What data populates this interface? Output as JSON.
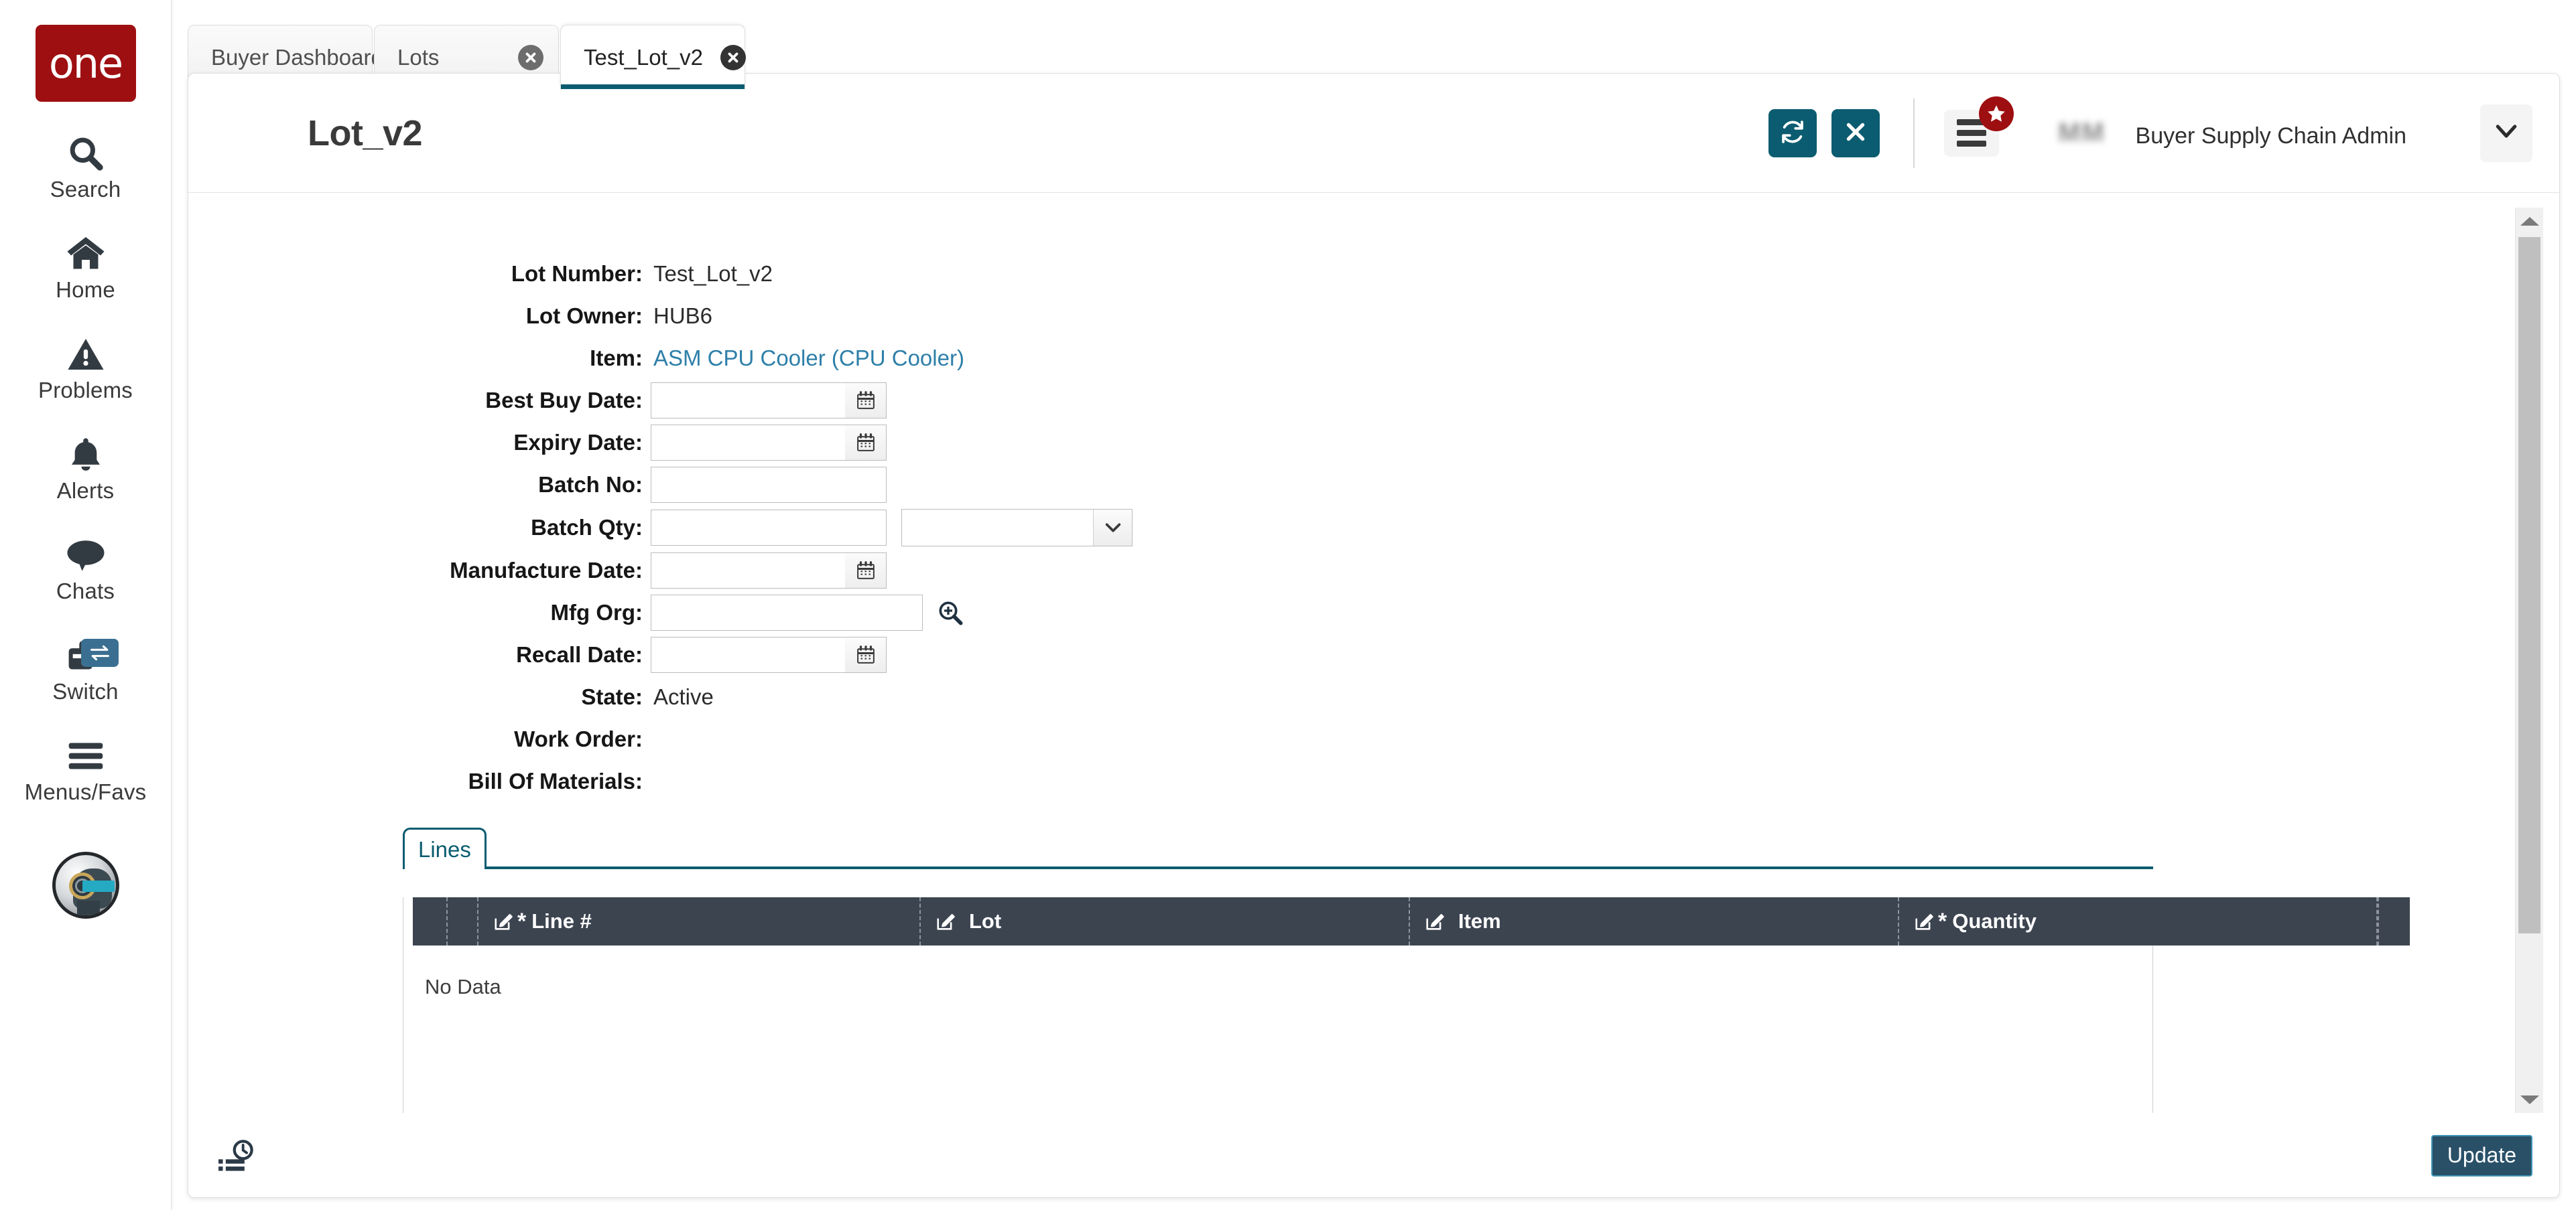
{
  "brand": {
    "logo_text": "one"
  },
  "sidebar": {
    "items": [
      {
        "label": "Search",
        "icon": "search-icon"
      },
      {
        "label": "Home",
        "icon": "home-icon"
      },
      {
        "label": "Problems",
        "icon": "warning-triangle-icon"
      },
      {
        "label": "Alerts",
        "icon": "bell-icon"
      },
      {
        "label": "Chats",
        "icon": "chat-bubble-icon"
      },
      {
        "label": "Switch",
        "icon": "windows-switch-icon",
        "badge_icon": "swap-arrows-icon"
      },
      {
        "label": "Menus/Favs",
        "icon": "hamburger-icon"
      }
    ],
    "avatar_icon": "robot-avatar-icon"
  },
  "browser_tabs": [
    {
      "label": "Buyer Dashboard",
      "active": false,
      "close_icon": "close-circle-icon"
    },
    {
      "label": "Lots",
      "active": false,
      "close_icon": "close-circle-icon"
    },
    {
      "label": "Test_Lot_v2",
      "active": true,
      "close_icon": "close-circle-icon"
    }
  ],
  "header": {
    "title": "Lot_v2",
    "refresh_icon": "refresh-icon",
    "close_icon": "close-x-icon",
    "menu_icon": "menu-bars-icon",
    "favorite_badge_icon": "star-icon",
    "user": {
      "initials": "MM",
      "name": "",
      "role": "Buyer Supply Chain Admin",
      "org": ""
    },
    "chevron_icon": "chevron-down-icon"
  },
  "form": {
    "lot_number": {
      "label": "Lot Number:",
      "value": "Test_Lot_v2"
    },
    "lot_owner": {
      "label": "Lot Owner:",
      "value": "HUB6"
    },
    "item": {
      "label": "Item:",
      "value": "ASM CPU Cooler (CPU Cooler)"
    },
    "best_buy_date": {
      "label": "Best Buy Date:",
      "value": "",
      "placeholder": "",
      "icon": "calendar-icon"
    },
    "expiry_date": {
      "label": "Expiry Date:",
      "value": "",
      "placeholder": "",
      "icon": "calendar-icon"
    },
    "batch_no": {
      "label": "Batch No:",
      "value": "",
      "placeholder": ""
    },
    "batch_qty": {
      "label": "Batch Qty:",
      "value": "",
      "placeholder": "",
      "uom_value": "",
      "uom_icon": "chevron-down-icon"
    },
    "manufacture_date": {
      "label": "Manufacture Date:",
      "value": "",
      "placeholder": "",
      "icon": "calendar-icon"
    },
    "mfg_org": {
      "label": "Mfg Org:",
      "value": "",
      "placeholder": "",
      "icon": "search-plus-icon"
    },
    "recall_date": {
      "label": "Recall Date:",
      "value": "",
      "placeholder": "",
      "icon": "calendar-icon"
    },
    "state": {
      "label": "State:",
      "value": "Active"
    },
    "work_order": {
      "label": "Work Order:",
      "value": ""
    },
    "bill_of_materials": {
      "label": "Bill Of Materials:",
      "value": ""
    }
  },
  "section_tabs": [
    {
      "label": "Lines",
      "active": true
    }
  ],
  "lines_grid": {
    "columns": [
      {
        "label": "Line #",
        "required": true,
        "edit_icon": "edit-pencil-icon"
      },
      {
        "label": "Lot",
        "required": false,
        "edit_icon": "edit-pencil-icon"
      },
      {
        "label": "Item",
        "required": false,
        "edit_icon": "edit-pencil-icon"
      },
      {
        "label": "Quantity",
        "required": true,
        "edit_icon": "edit-pencil-icon"
      }
    ],
    "rows": [],
    "empty_text": "No Data",
    "required_marker": "*"
  },
  "footer": {
    "history_icon": "history-list-icon",
    "update_label": "Update"
  },
  "colors": {
    "brand_red": "#9e0f11",
    "accent_teal": "#0b5c70",
    "grid_header": "#3c4450",
    "link_blue": "#2d7fa8",
    "update_button": "#2a5068",
    "switch_badge": "#3b6f91"
  }
}
